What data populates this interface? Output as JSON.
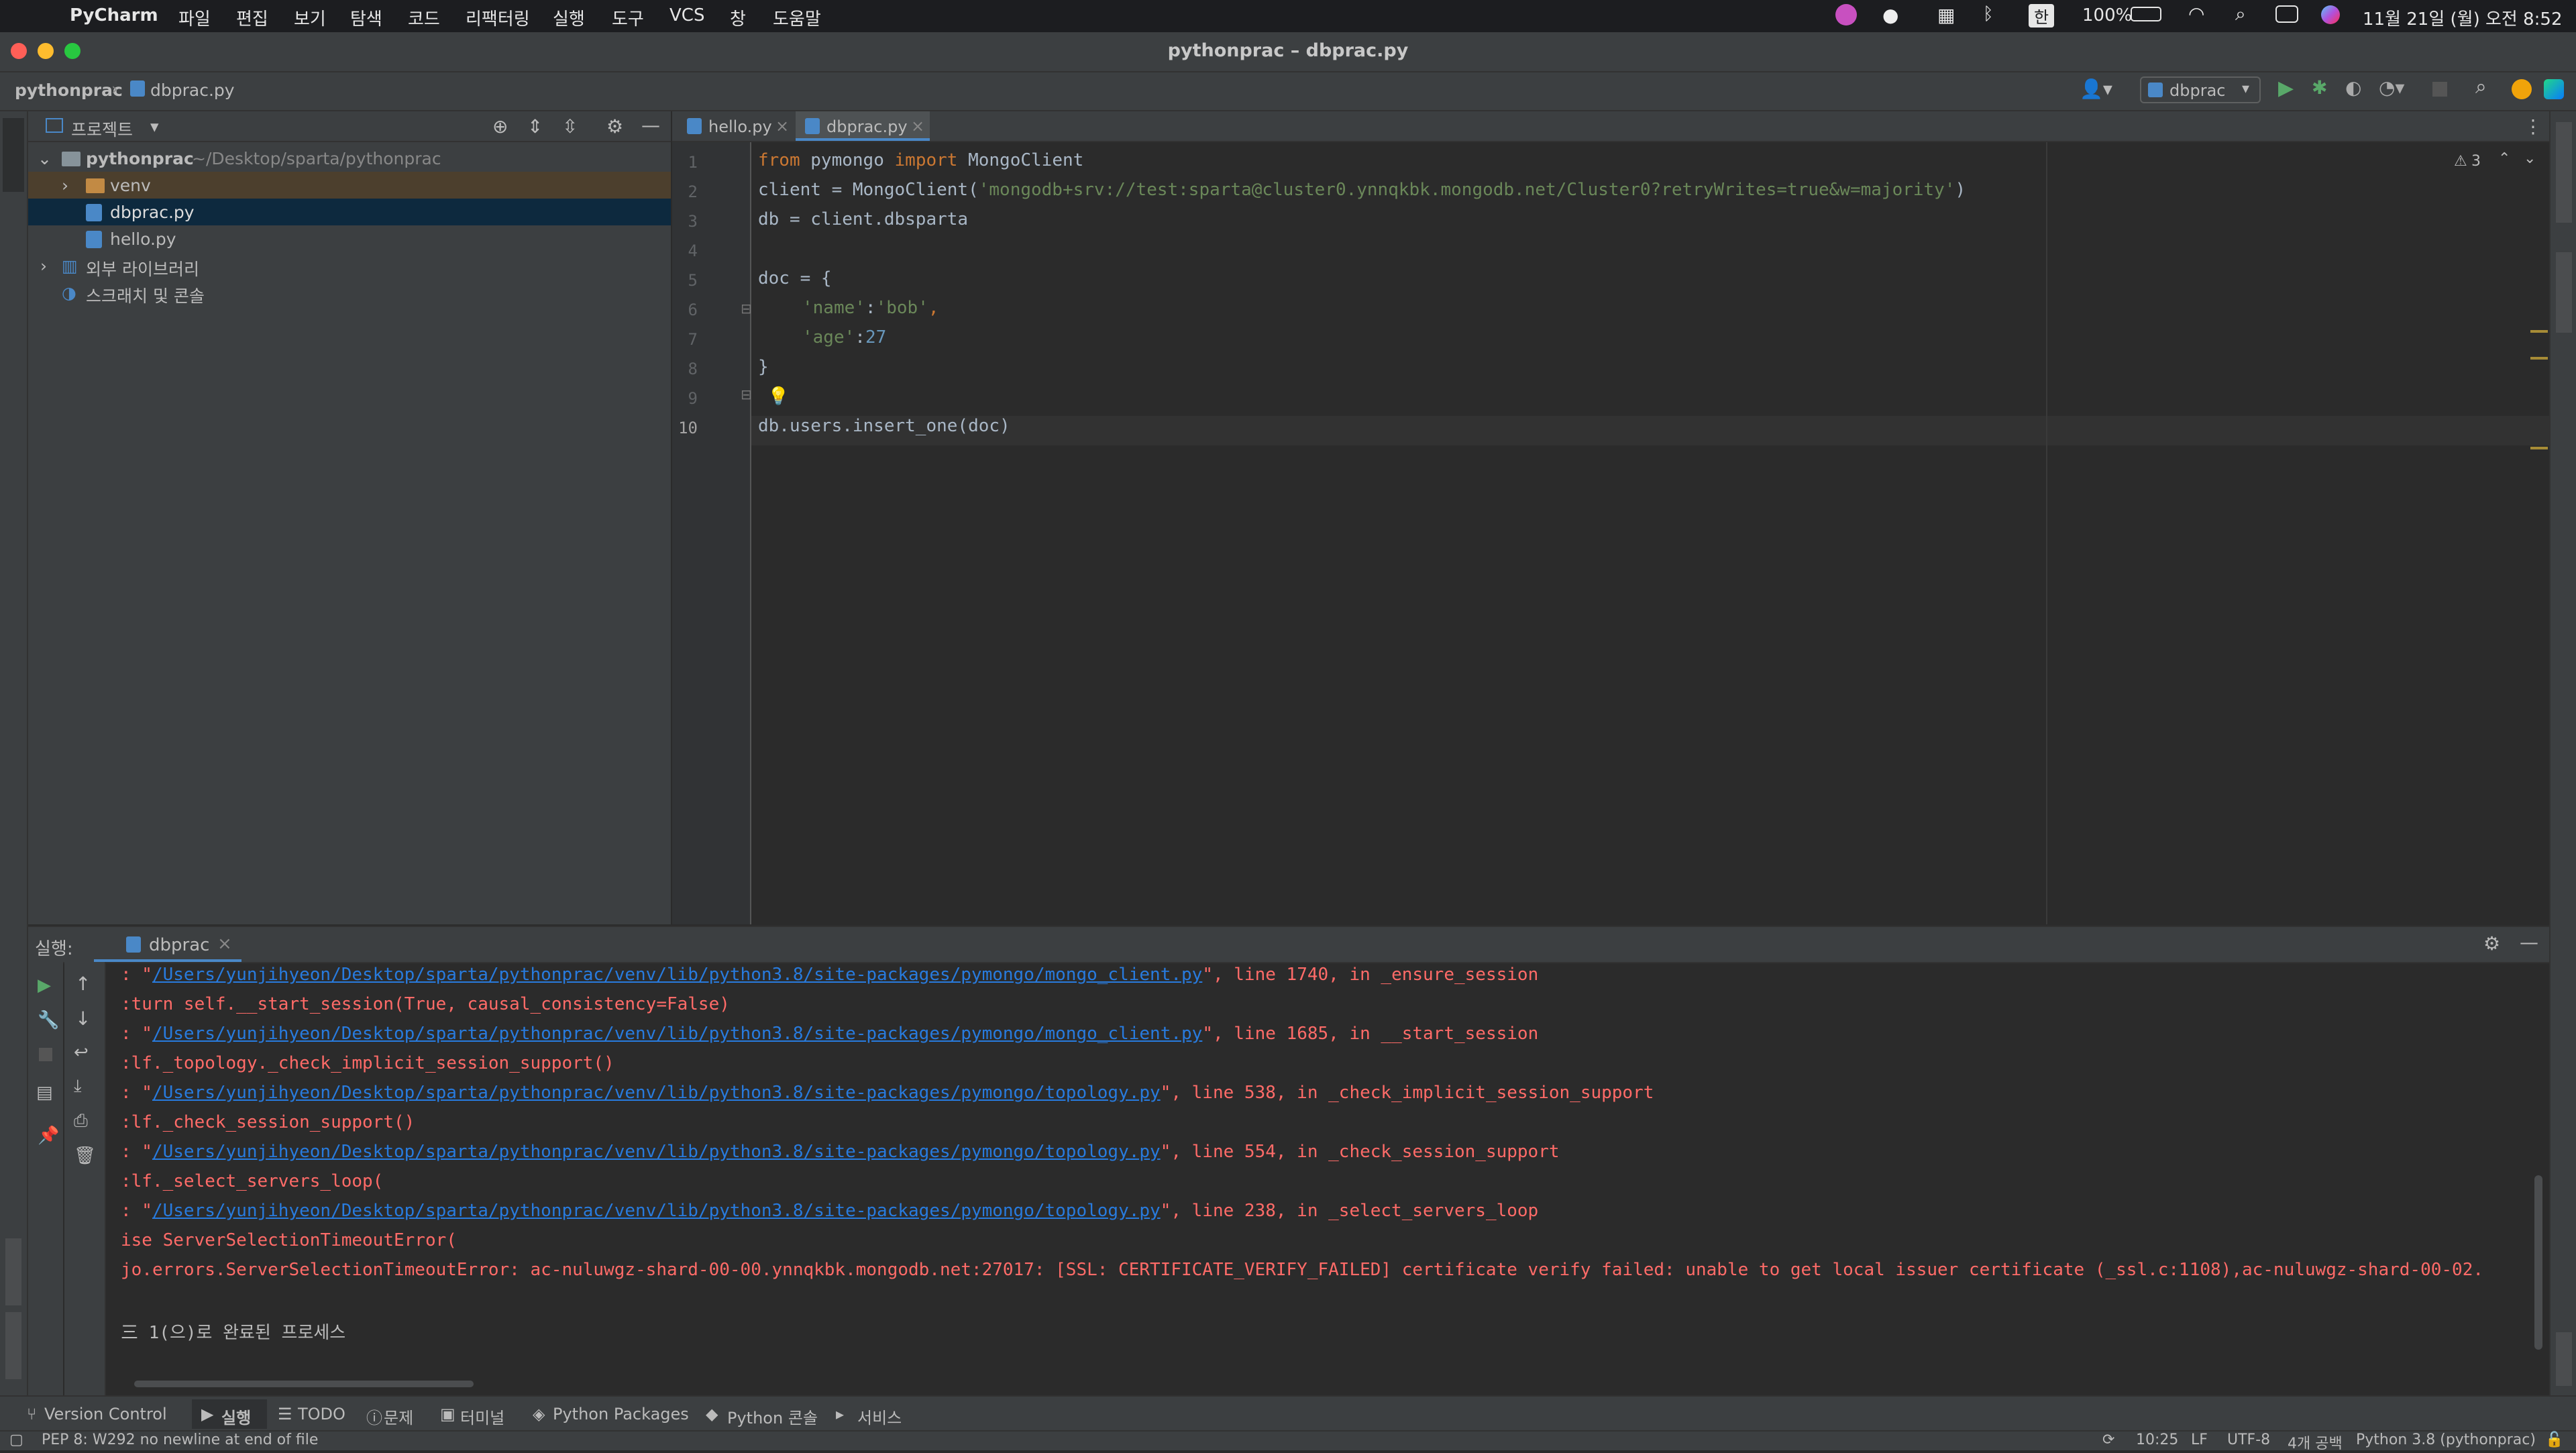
{
  "menubar": {
    "app": "PyCharm",
    "items": [
      "파일",
      "편집",
      "보기",
      "탐색",
      "코드",
      "리팩터링",
      "실행",
      "도구",
      "VCS",
      "창",
      "도움말"
    ],
    "battery": "100%",
    "input_source": "한",
    "clock": "11월 21일 (월) 오전 8:52"
  },
  "window": {
    "title": "pythonprac – dbprac.py"
  },
  "navbar": {
    "crumb_project": "pythonprac",
    "crumb_file": "dbprac.py",
    "run_config": "dbprac"
  },
  "project_panel": {
    "header": "프로젝트",
    "tree": [
      {
        "label": "pythonprac",
        "path": "~/Desktop/sparta/pythonprac"
      },
      {
        "label": "venv"
      },
      {
        "label": "dbprac.py"
      },
      {
        "label": "hello.py"
      },
      {
        "label": "외부 라이브러리"
      },
      {
        "label": "스크래치 및 콘솔"
      }
    ]
  },
  "editor": {
    "tabs": [
      {
        "label": "hello.py"
      },
      {
        "label": "dbprac.py"
      }
    ],
    "warnings": "3",
    "line_numbers": [
      "1",
      "2",
      "3",
      "4",
      "5",
      "6",
      "7",
      "8",
      "9",
      "10"
    ],
    "code": {
      "l1_from": "from",
      "l1_mod": " pymongo ",
      "l1_import": "import",
      "l1_name": " MongoClient",
      "l2_a": "client = MongoClient(",
      "l2_str": "'mongodb+srv://test:sparta@cluster0.ynnqkbk.mongodb.net/Cluster0?retryWrites=true&w=majority'",
      "l2_b": ")",
      "l3": "db = client.dbsparta",
      "l5": "doc = {",
      "l6_key": "'name'",
      "l6_sep": ":",
      "l6_val": "'bob'",
      "l6_end": ",",
      "l7_key": "'age'",
      "l7_sep": ":",
      "l7_val": "27",
      "l8": "}",
      "l10": "db.users.insert_one(doc)"
    }
  },
  "run_panel": {
    "label": "실행:",
    "tab": "dbprac",
    "output": [
      {
        "pre": ": \"",
        "link": "/Users/yunjihyeon/Desktop/sparta/pythonprac/venv/lib/python3.8/site-packages/pymongo/mongo_client.py",
        "post": "\", line 1740, in _ensure_session"
      },
      {
        "text": ":turn self.__start_session(True, causal_consistency=False)"
      },
      {
        "pre": ": \"",
        "link": "/Users/yunjihyeon/Desktop/sparta/pythonprac/venv/lib/python3.8/site-packages/pymongo/mongo_client.py",
        "post": "\", line 1685, in __start_session"
      },
      {
        "text": ":lf._topology._check_implicit_session_support()"
      },
      {
        "pre": ": \"",
        "link": "/Users/yunjihyeon/Desktop/sparta/pythonprac/venv/lib/python3.8/site-packages/pymongo/topology.py",
        "post": "\", line 538, in _check_implicit_session_support"
      },
      {
        "text": ":lf._check_session_support()"
      },
      {
        "pre": ": \"",
        "link": "/Users/yunjihyeon/Desktop/sparta/pythonprac/venv/lib/python3.8/site-packages/pymongo/topology.py",
        "post": "\", line 554, in _check_session_support"
      },
      {
        "text": ":lf._select_servers_loop("
      },
      {
        "pre": ": \"",
        "link": "/Users/yunjihyeon/Desktop/sparta/pythonprac/venv/lib/python3.8/site-packages/pymongo/topology.py",
        "post": "\", line 238, in _select_servers_loop"
      },
      {
        "text": "ise ServerSelectionTimeoutError("
      },
      {
        "text": "jo.errors.ServerSelectionTimeoutError: ac-nuluwgz-shard-00-00.ynnqkbk.mongodb.net:27017: [SSL: CERTIFICATE_VERIFY_FAILED] certificate verify failed: unable to get local issuer certificate (_ssl.c:1108),ac-nuluwgz-shard-00-02."
      },
      {
        "text": ""
      },
      {
        "text": "三 1(으)로 완료된 프로세스"
      }
    ]
  },
  "tool_windows": [
    "Version Control",
    "실행",
    "TODO",
    "문제",
    "터미널",
    "Python Packages",
    "Python 콘솔",
    "서비스"
  ],
  "status": {
    "message": "PEP 8: W292 no newline at end of file",
    "position": "10:25",
    "line_sep": "LF",
    "encoding": "UTF-8",
    "indent": "4개 공백",
    "interpreter": "Python 3.8 (pythonprac)"
  },
  "colors": {
    "accent": "#4a88c7",
    "selection": "#0d293e",
    "error_text": "#ff6b68",
    "link": "#287bde",
    "keyword": "#cc7832",
    "string": "#6a8759",
    "number": "#6897bb"
  }
}
